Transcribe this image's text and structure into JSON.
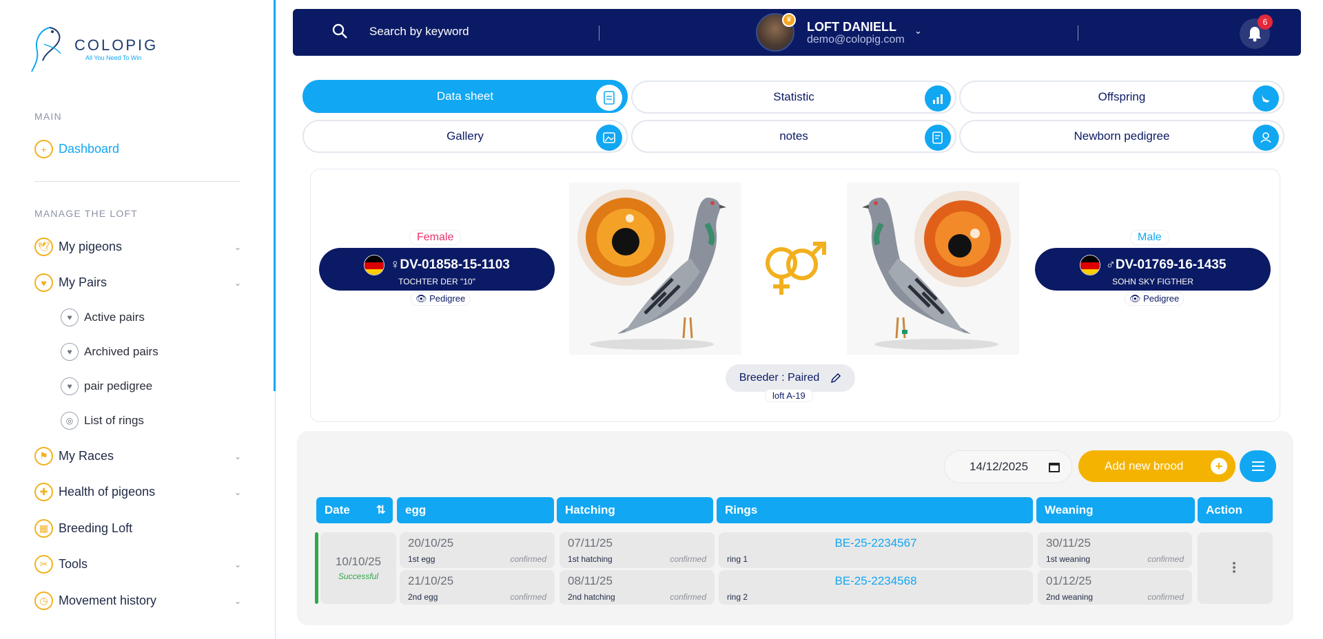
{
  "brand": {
    "name": "COLOPIG",
    "tagline": "All You Need To Win"
  },
  "sidebar": {
    "main_section": "MAIN",
    "dashboard": "Dashboard",
    "manage_section": "MANAGE THE LOFT",
    "items": [
      {
        "label": "My pigeons",
        "chevron": true
      },
      {
        "label": "My Pairs",
        "chevron": true
      },
      {
        "label": "My Races",
        "chevron": true
      },
      {
        "label": "Health of pigeons",
        "chevron": true
      },
      {
        "label": "Breeding Loft",
        "chevron": false
      },
      {
        "label": "Tools",
        "chevron": true
      },
      {
        "label": "Movement history",
        "chevron": true
      }
    ],
    "pairs_sub": [
      "Active pairs",
      "Archived pairs",
      "pair pedigree",
      "List of rings"
    ]
  },
  "topbar": {
    "search_placeholder": "Search by keyword",
    "user_name": "LOFT DANIELL",
    "user_email": "demo@colopig.com",
    "notification_count": "6"
  },
  "tabs": [
    "Data sheet",
    "Statistic",
    "Offspring",
    "Gallery",
    "notes",
    "Newborn pedigree"
  ],
  "pair": {
    "female": {
      "sex": "Female",
      "ring": "DV-01858-15-1103",
      "name": "TOCHTER DER \"10\"",
      "pedigree": "Pedigree",
      "symbol": "♀"
    },
    "male": {
      "sex": "Male",
      "ring": "DV-01769-16-1435",
      "name": "SOHN SKY FIGTHER",
      "pedigree": "Pedigree",
      "symbol": "♂"
    },
    "breeder_status": "Breeder : Paired",
    "loft": "loft A-19",
    "colors": {
      "female": "#e8326b",
      "male": "#11a7f2",
      "accent": "#f2b01e",
      "navy": "#0b1a64"
    }
  },
  "brood": {
    "date_value": "14/12/2025",
    "add_label": "Add new brood",
    "headers": [
      "Date",
      "egg",
      "Hatching",
      "Rings",
      "Weaning",
      "Action"
    ],
    "row": {
      "date": "10/10/25",
      "status": "Successful",
      "eggs": [
        {
          "date": "20/10/25",
          "label": "1st egg",
          "state": "confirmed"
        },
        {
          "date": "21/10/25",
          "label": "2nd egg",
          "state": "confirmed"
        }
      ],
      "hatching": [
        {
          "date": "07/11/25",
          "label": "1st hatching",
          "state": "confirmed"
        },
        {
          "date": "08/11/25",
          "label": "2nd hatching",
          "state": "confirmed"
        }
      ],
      "rings": [
        {
          "value": "BE-25-2234567",
          "label": "ring 1"
        },
        {
          "value": "BE-25-2234568",
          "label": "ring 2"
        }
      ],
      "weaning": [
        {
          "date": "30/11/25",
          "label": "1st weaning",
          "state": "confirmed"
        },
        {
          "date": "01/12/25",
          "label": "2nd weaning",
          "state": "confirmed"
        }
      ]
    }
  }
}
